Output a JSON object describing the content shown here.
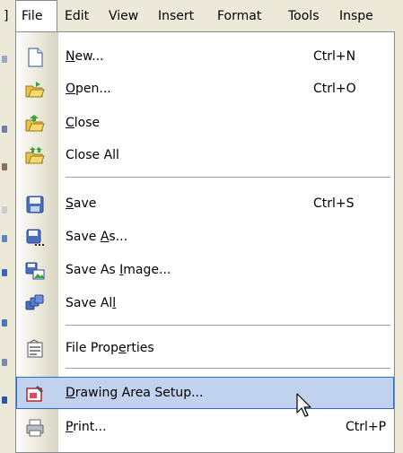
{
  "menubar": {
    "items": [
      {
        "label": "File"
      },
      {
        "label": "Edit"
      },
      {
        "label": "View"
      },
      {
        "label": "Insert"
      },
      {
        "label": "Format"
      },
      {
        "label": "Tools"
      },
      {
        "label": "Inspe"
      }
    ]
  },
  "file_menu": {
    "items": [
      {
        "icon": "new-document-icon",
        "label": "New...",
        "accel_char": "N",
        "shortcut": "Ctrl+N"
      },
      {
        "icon": "open-folder-icon",
        "label": "Open...",
        "accel_char": "O",
        "shortcut": "Ctrl+O"
      },
      {
        "icon": "close-folder-icon",
        "label": "Close",
        "accel_char": "C",
        "shortcut": ""
      },
      {
        "icon": "close-all-folders-icon",
        "label": "Close All",
        "accel_char": "",
        "shortcut": ""
      },
      {
        "icon": "save-disk-icon",
        "label": "Save",
        "accel_char": "S",
        "shortcut": "Ctrl+S"
      },
      {
        "icon": "save-as-disk-icon",
        "label": "Save As...",
        "accel_char": "A",
        "shortcut": ""
      },
      {
        "icon": "save-as-image-icon",
        "label": "Save As Image...",
        "accel_char": "I",
        "shortcut": ""
      },
      {
        "icon": "save-all-icon",
        "label": "Save All",
        "accel_char": "l",
        "shortcut": ""
      },
      {
        "icon": "file-properties-icon",
        "label": "File Properties",
        "accel_char": "e",
        "shortcut": ""
      },
      {
        "icon": "drawing-area-setup-icon",
        "label": "Drawing Area Setup...",
        "accel_char": "D",
        "shortcut": ""
      },
      {
        "icon": "print-icon",
        "label": "Print...",
        "accel_char": "P",
        "shortcut": "Ctrl+P"
      }
    ],
    "highlighted_item": "Drawing Area Setup..."
  }
}
